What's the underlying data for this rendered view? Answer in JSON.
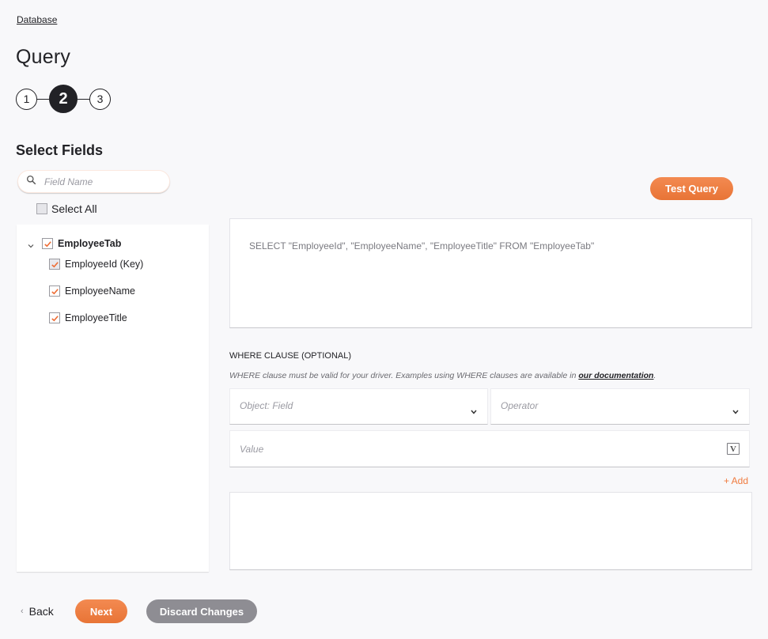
{
  "breadcrumb": "Database",
  "page_title": "Query",
  "stepper": {
    "steps": [
      "1",
      "2",
      "3"
    ],
    "active_step": 2
  },
  "select_fields": {
    "title": "Select Fields",
    "search_placeholder": "Field Name",
    "select_all_label": "Select All",
    "select_all_checked": false,
    "tree": {
      "table": {
        "label": "EmployeeTab",
        "checked": true,
        "expanded": true
      },
      "fields": [
        {
          "label": "EmployeeId (Key)",
          "checked": true
        },
        {
          "label": "EmployeeName",
          "checked": true
        },
        {
          "label": "EmployeeTitle",
          "checked": true
        }
      ]
    }
  },
  "test_query_label": "Test Query",
  "sql_query": "SELECT \"EmployeeId\", \"EmployeeName\", \"EmployeeTitle\" FROM \"EmployeeTab\"",
  "where_clause": {
    "heading": "WHERE CLAUSE (OPTIONAL)",
    "help_text": "WHERE clause must be valid for your driver. Examples using WHERE clauses are available in ",
    "help_link": "our documentation",
    "help_suffix": ".",
    "object_field_placeholder": "Object: Field",
    "operator_placeholder": "Operator",
    "value_placeholder": "Value",
    "variable_icon_glyph": "V",
    "add_label": "+ Add"
  },
  "footer": {
    "back_label": "Back",
    "back_icon": "‹",
    "next_label": "Next",
    "discard_label": "Discard Changes"
  },
  "colors": {
    "accent": "#ee7d43",
    "dark": "#222226",
    "discard_gray": "#8e8d93",
    "background": "#f8f8fa"
  }
}
